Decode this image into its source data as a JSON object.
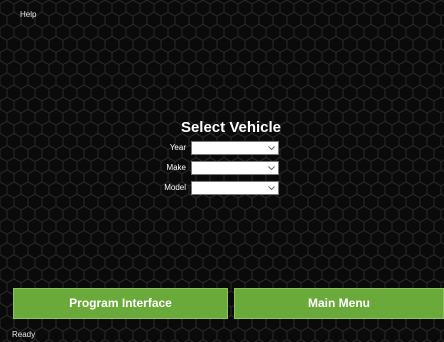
{
  "menu": {
    "help_label": "Help"
  },
  "main": {
    "title": "Select Vehicle",
    "fields": [
      {
        "label": "Year",
        "value": "",
        "icon": "chevron-down-icon"
      },
      {
        "label": "Make",
        "value": "",
        "icon": "chevron-down-icon"
      },
      {
        "label": "Model",
        "value": "",
        "icon": "chevron-down-icon"
      }
    ]
  },
  "buttons": {
    "program_interface_label": "Program Interface",
    "main_menu_label": "Main Menu"
  },
  "status": {
    "text": "Ready"
  },
  "colors": {
    "background": "#0a0a0a",
    "hex_stroke": "#2c2c2c",
    "button_green": "#6aaa3a",
    "text_white": "#ffffff"
  }
}
